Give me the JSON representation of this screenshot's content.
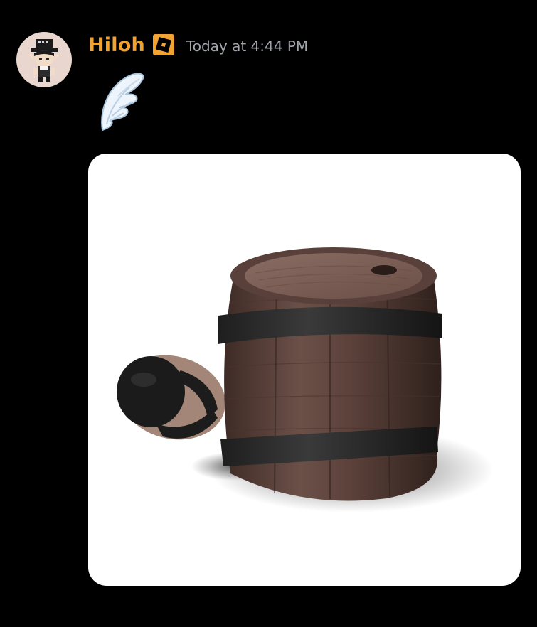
{
  "message": {
    "author": {
      "name": "Hiloh",
      "name_color": "#f0a332",
      "badge_icon": "roblox-logo-icon",
      "avatar_icon": "character-avatar-icon"
    },
    "timestamp": "Today at 4:44 PM",
    "emoji": "angel-wing-emoji",
    "attachment": {
      "type": "image",
      "subject": "barrel-with-tail-icon",
      "background": "#ffffff"
    }
  },
  "colors": {
    "background": "#000000",
    "timestamp": "#a3a6ad",
    "badge": "#f0a332"
  }
}
